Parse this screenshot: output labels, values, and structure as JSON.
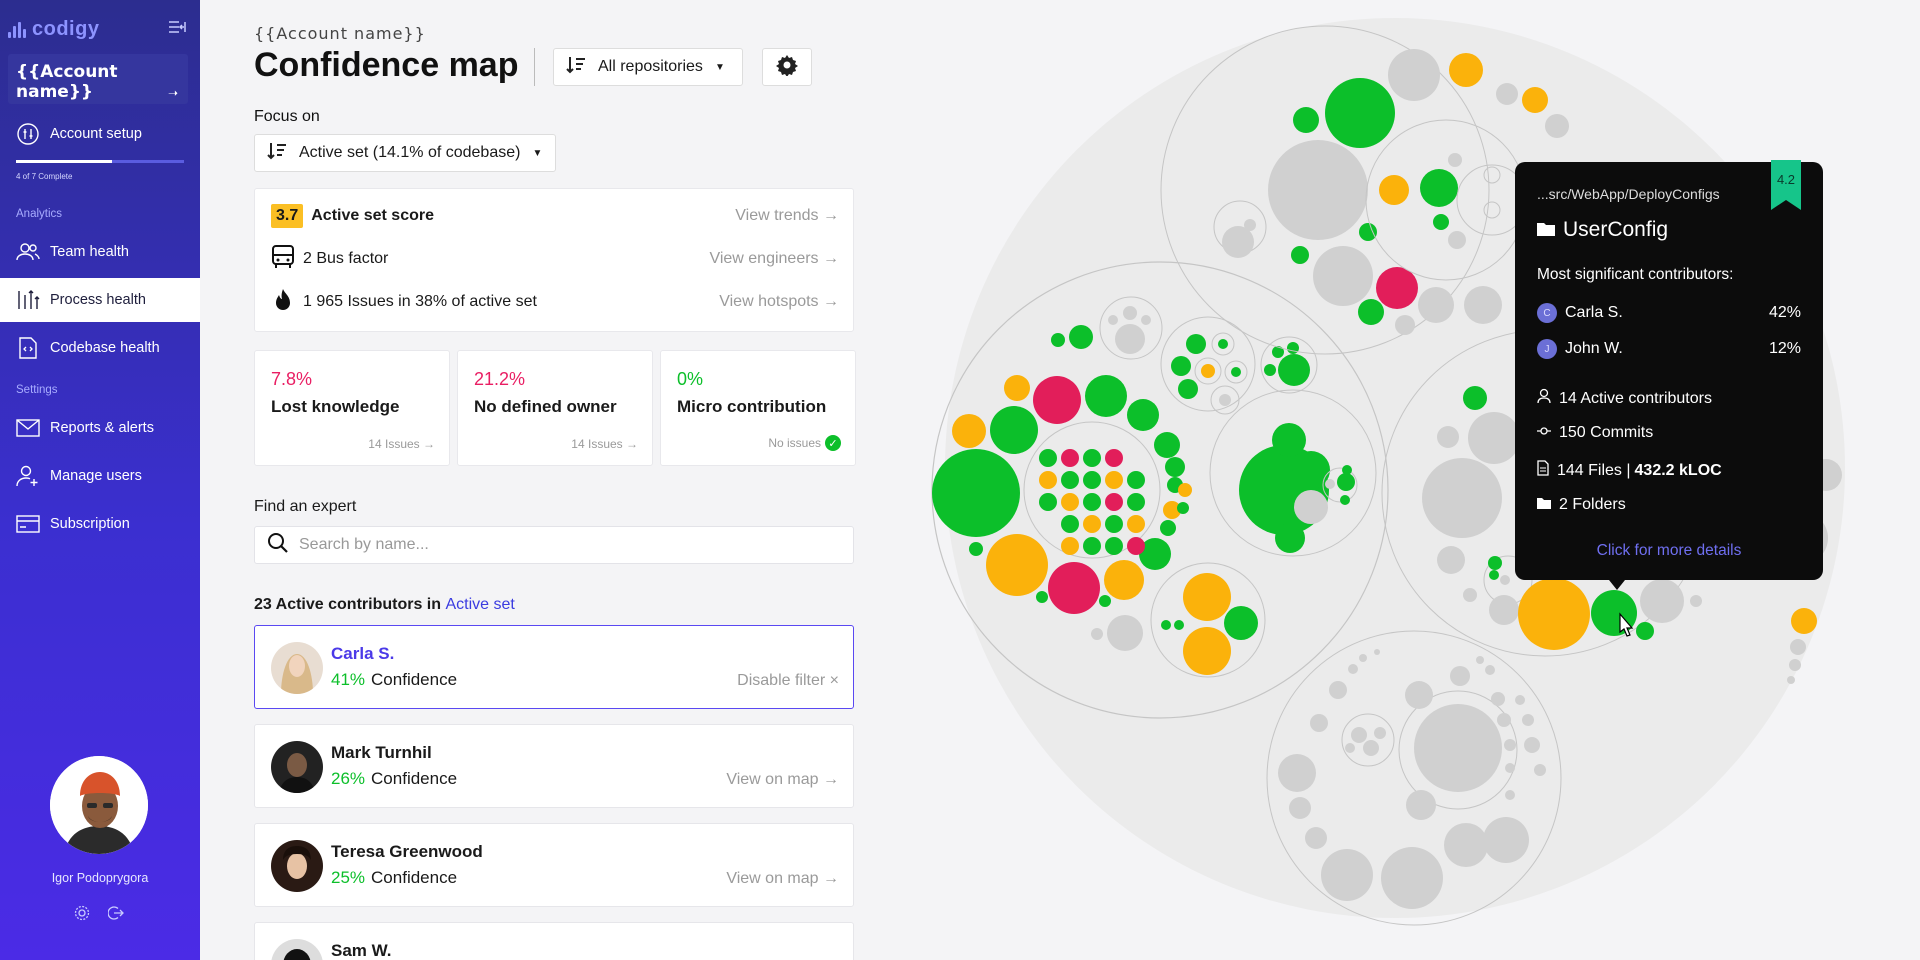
{
  "sidebar": {
    "logo": "codigy",
    "account_name": "{{Account name}}",
    "account_setup": "Account setup",
    "progress_text": "4 of 7 Complete",
    "progress_fraction": 0.571,
    "analytics_label": "Analytics",
    "settings_label": "Settings",
    "items": [
      {
        "label": "Team health",
        "icon": "team-icon"
      },
      {
        "label": "Process health",
        "icon": "process-icon"
      },
      {
        "label": "Codebase health",
        "icon": "codebase-icon"
      },
      {
        "label": "Reports & alerts",
        "icon": "mail-icon"
      },
      {
        "label": "Manage users",
        "icon": "user-add-icon"
      },
      {
        "label": "Subscription",
        "icon": "card-icon"
      }
    ],
    "user_name": "Igor Podoprygora"
  },
  "header": {
    "account_label": "{{Account name}}",
    "title": "Confidence map",
    "repo_select": "All repositories",
    "focus_label": "Focus on",
    "focus_select": "Active set (14.1% of codebase)"
  },
  "score_card": {
    "score": "3.7",
    "score_label": "Active set score",
    "trends_link": "View trends →",
    "bus_factor": "2 Bus factor",
    "engineers_link": "View engineers →",
    "issues": "1 965 Issues in 38% of active set",
    "hotspots_link": "View hotspots →"
  },
  "metrics": [
    {
      "pct": "7.8%",
      "label": "Lost knowledge",
      "note": "14 Issues →",
      "color": "#e91e63"
    },
    {
      "pct": "21.2%",
      "label": "No defined owner",
      "note": "14 Issues →",
      "color": "#e91e63"
    },
    {
      "pct": "0%",
      "label": "Micro contribution",
      "note": "No issues",
      "color": "#0cbf2a"
    }
  ],
  "expert": {
    "label": "Find an expert",
    "placeholder": "Search by name..."
  },
  "contributors": {
    "heading": "23 Active contributors in",
    "heading_link": "Active set",
    "list": [
      {
        "name": "Carla S.",
        "pct": "41%",
        "conf": "Confidence",
        "action": "Disable filter ×"
      },
      {
        "name": "Mark Turnhil",
        "pct": "26%",
        "conf": "Confidence",
        "action": "View on map →"
      },
      {
        "name": "Teresa Greenwood",
        "pct": "25%",
        "conf": "Confidence",
        "action": "View on map →"
      },
      {
        "name": "Sam W.",
        "pct": "",
        "conf": "",
        "action": ""
      }
    ]
  },
  "tooltip": {
    "path": "...src/WebApp/DeployConfigs",
    "folder": "UserConfig",
    "score": "4.2",
    "section": "Most significant contributors:",
    "contributors": [
      {
        "initial": "C",
        "name": "Carla S.",
        "pct": "42%"
      },
      {
        "initial": "J",
        "name": "John W.",
        "pct": "12%"
      }
    ],
    "active_contributors": "14 Active contributors",
    "commits": "150 Commits",
    "files": "144 Files |",
    "kloc": "432.2 kLOC",
    "folders": "2 Folders",
    "more": "Click for more details"
  },
  "colors": {
    "green": "#0cbf2a",
    "yellow": "#fbb20b",
    "red": "#e21e5a",
    "gray": "#d0d0d0"
  }
}
